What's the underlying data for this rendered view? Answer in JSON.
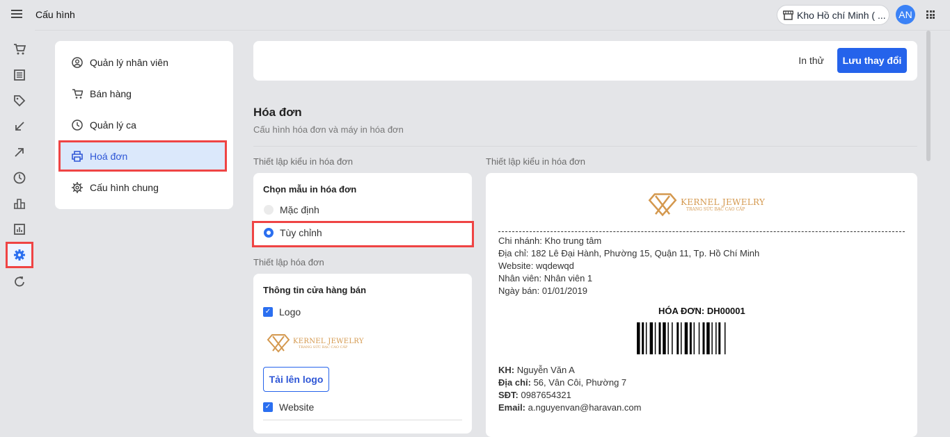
{
  "header": {
    "title": "Cấu hình",
    "store": "Kho Hồ chí Minh ( ...",
    "avatar": "AN"
  },
  "rail": [
    "cart-icon",
    "receipt-icon",
    "tag-icon",
    "import-icon",
    "export-icon",
    "clock-icon",
    "bar-chart-icon",
    "report-icon",
    "settings-icon",
    "sync-icon"
  ],
  "submenu": [
    {
      "label": "Quản lý nhân viên"
    },
    {
      "label": "Bán hàng"
    },
    {
      "label": "Quản lý ca"
    },
    {
      "label": "Hoá đơn"
    },
    {
      "label": "Cấu hình chung"
    }
  ],
  "actions": {
    "print_test": "In thử",
    "save": "Lưu thay đổi"
  },
  "section": {
    "title": "Hóa đơn",
    "subtitle": "Cấu hình hóa đơn và máy in hóa đơn",
    "print_style_label": "Thiết lập kiểu in hóa đơn",
    "invoice_setup_label": "Thiết lập hóa đơn",
    "preview_label": "Thiết lập kiểu in hóa đơn"
  },
  "template": {
    "title": "Chọn mẫu in hóa đơn",
    "options": [
      "Mặc định",
      "Tùy chỉnh"
    ],
    "selected": "Tùy chỉnh"
  },
  "store_info": {
    "title": "Thông tin cửa hàng bán",
    "logo": "Logo",
    "upload": "Tải lên logo",
    "website": "Website"
  },
  "brand": {
    "name": "KERNEL JEWELRY",
    "tagline": "TRANG SỨC BẠC CAO CẤP",
    "color": "#d4984e"
  },
  "receipt": {
    "lines": [
      "Chi nhánh: Kho trung tâm",
      "Địa chỉ: 182 Lê Đại Hành, Phường 15, Quận 11, Tp. Hồ Chí Minh",
      "Website: wqdewqd",
      "Nhân viên: Nhân viên 1",
      "Ngày bán: 01/01/2019"
    ],
    "invoice_title": "HÓA ĐƠN: DH00001",
    "customer": [
      {
        "k": "KH:",
        "v": " Nguyễn Văn A"
      },
      {
        "k": "Địa chỉ:",
        "v": " 56, Vân Côi, Phường 7"
      },
      {
        "k": "SĐT:",
        "v": " 0987654321"
      },
      {
        "k": "Email:",
        "v": " a.nguyenvan@haravan.com"
      }
    ]
  },
  "colors": {
    "primary": "#2563eb",
    "highlight": "#ef4444"
  }
}
